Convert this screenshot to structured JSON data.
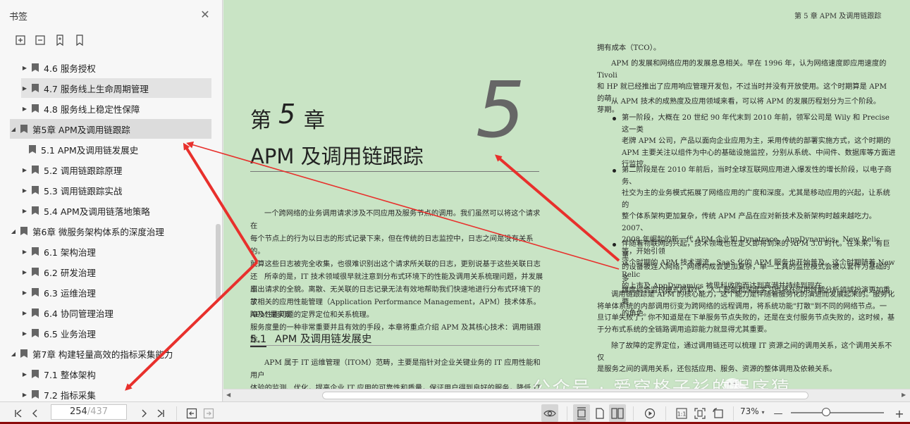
{
  "sidebar": {
    "title": "书签",
    "close_icon": "close-icon",
    "tools": [
      "expand-bookmarks-icon",
      "collapse-bookmarks-icon",
      "add-bookmark-icon",
      "bookmark-icon"
    ],
    "items": [
      {
        "label": "4.6  服务授权",
        "level": 2,
        "expanded": false
      },
      {
        "label": "4.7  服务线上生命周期管理",
        "level": 2,
        "expanded": false
      },
      {
        "label": "4.8  服务线上稳定性保障",
        "level": 2,
        "expanded": false
      },
      {
        "label": "第5章  APM及调用链跟踪",
        "level": 1,
        "expanded": true
      },
      {
        "label": "5.1  APM及调用链发展史",
        "level": 2,
        "expanded": null
      },
      {
        "label": "5.2  调用链跟踪原理",
        "level": 2,
        "expanded": false
      },
      {
        "label": "5.3  调用链跟踪实战",
        "level": 2,
        "expanded": false
      },
      {
        "label": "5.4  APM及调用链落地策略",
        "level": 2,
        "expanded": false
      },
      {
        "label": "第6章  微服务架构体系的深度治理",
        "level": 1,
        "expanded": true
      },
      {
        "label": "6.1  架构治理",
        "level": 2,
        "expanded": false
      },
      {
        "label": "6.2  研发治理",
        "level": 2,
        "expanded": false
      },
      {
        "label": "6.3  运维治理",
        "level": 2,
        "expanded": false
      },
      {
        "label": "6.4  协同管理治理",
        "level": 2,
        "expanded": false
      },
      {
        "label": "6.5  业务治理",
        "level": 2,
        "expanded": false
      },
      {
        "label": "第7章  构建轻量高效的指标采集能力",
        "level": 1,
        "expanded": true
      },
      {
        "label": "7.1  整体架构",
        "level": 2,
        "expanded": false
      },
      {
        "label": "7.2  指标采集",
        "level": 2,
        "expanded": false
      }
    ]
  },
  "doc": {
    "left_page": {
      "chapter_prefix": "第",
      "chapter_num": "5",
      "chapter_suffix": "章",
      "chapter_big_num": "5",
      "chapter_title": "APM 及调用链跟踪",
      "intro_p1": [
        "一个跨网络的业务调用请求涉及不同应用及服务节点的调用。我们虽然可以将这个请求在",
        "每个节点上的行为以日志的形式记录下来，但在传统的日志监控中，日志之间是没有关系的。",
        "就算这些日志被完全收集，也很难识别出这个请求所关联的日志，更别说基于这些关联日志还",
        "原出请求的全貌。离散、无关联的日志记录无法有效地帮助我们快速地进行分布式环境下的故",
        "障及性能问题的定界定位和关系梳理。"
      ],
      "intro_p2": [
        "所幸的是，IT 技术领域很早就注意到分布式环境下的性能及调用关系梳理问题，并发展出",
        "了相关的应用性能管理（Application Performance Management，APM）技术体系。APM 是实现",
        "服务度量的一种非常重要并且有效的手段，本章将重点介绍 APM 及其核心技术：调用链跟踪。"
      ],
      "section_num": "5.1",
      "section_title": "APM 及调用链发展史",
      "sec_p": [
        "APM 属于 IT 运维管理（ITOM）范畴，主要是指针对企业关键业务的 IT 应用性能和用户",
        "体验的监测、优化，提高企业 IT 应用的可靠性和质量，保证用户得到良好的服务，降低 IT 总"
      ]
    },
    "right_page": {
      "header": "第 5 章   APM 及调用链跟踪",
      "p0": "拥有成本（TCO）。",
      "p1": [
        "APM 的发展和网络应用的发展息息相关。早在 1996 年，认为网络速度即应用速度的 Tivoli",
        "和 HP 就已经推出了应用响应管理开发包，不过当时并没有开放使用。这个时期算是 APM 的萌",
        "芽期。"
      ],
      "p2": "从 APM 技术的成熟度及应用领域来看，可以将 APM 的发展历程划分为三个阶段。",
      "b1": [
        "第一阶段，大概在 20 世纪 90 年代末到 2010 年前，领军公司是 Wily 和 Precise 这一类",
        "老牌 APM 公司，产品以面向企业应用为主，采用传统的部署实施方式，这个时期的",
        "APM 主要关注以组件为中心的基础设施监控，分别从系统、中间件、数据库等方面进",
        "行监控。"
      ],
      "b2": [
        "第二阶段是在 2010 年前后，当时全球互联网应用进入爆发性的增长阶段，以电子商务、",
        "社交为主的业务模式拓展了网络应用的广度和深度。尤其是移动应用的兴起，让系统的",
        "整个体系架构更加复杂，传统 APM 产品在应对新技术及新架构时越来越吃力。2007、",
        "2008 年崛起的新一代 APM 企业如 Dynatrace、AppDynamics、New Relic 等，开始引领",
        "这个时期的 APM 技术潮流，SaaS 化的 APM 服务也开始普及。这个时期随着 New Relic",
        "的上市及 AppDynamics 被思科收购而达到高潮并持续到现在。"
      ],
      "b3": [
        "伴随着物联网的兴起，技术领域也在定义即将到来的 APM 3.0 时代。在未来，有巨量",
        "的设备被连入网络，网络构成会更加复杂，单一工具的监控模式会被以套件为基础的多",
        "维度综合监控模式所取代，人工智能和深度学习也将在应用性能分析领域扮演更加重要",
        "的角色。"
      ],
      "p3": [
        "调用链跟踪是 APM 的核心能力，这个能力是伴随着服务化的演进而发展起来的。服务化",
        "将单体系统的内部调用衍变为跨网络的远程调用，将系统功能\"打散\"到不同的网络节点。一",
        "旦订单失败了，你不知道是在下单服务节点失败的，还是在支付服务节点失败的，这时候，基",
        "于分布式系统的全链路调用追踪能力就显得尤其重要。"
      ],
      "p4": [
        "除了故障的定界定位，通过调用链还可以梳理 IT 资源之间的调用关系，这个调用关系不仅",
        "是服务之间的调用关系，还包括应用、服务、资源的整体调用及依赖关系。"
      ]
    },
    "watermark": "公众号 · 爱穿格子衫的程序猿"
  },
  "toolbar": {
    "current_page": "254",
    "total_pages": "/437",
    "zoom": "73%",
    "zoom_level_fraction": 0.38,
    "icons": [
      "first-page-icon",
      "prev-page-icon",
      "next-page-icon",
      "last-page-icon",
      "back-icon",
      "forward-icon",
      "eye-icon",
      "continuous-page-icon",
      "single-page-icon",
      "two-page-icon",
      "play-icon",
      "actual-size-icon",
      "fit-page-icon",
      "rotate-icon",
      "zoom-out-icon",
      "zoom-in-icon"
    ]
  },
  "colors": {
    "page_bg": "#c9e4c5",
    "sidebar_bg": "#f7f7f7",
    "arrow_red": "#e8302c",
    "bottom_strip": "#8b0a0a"
  }
}
